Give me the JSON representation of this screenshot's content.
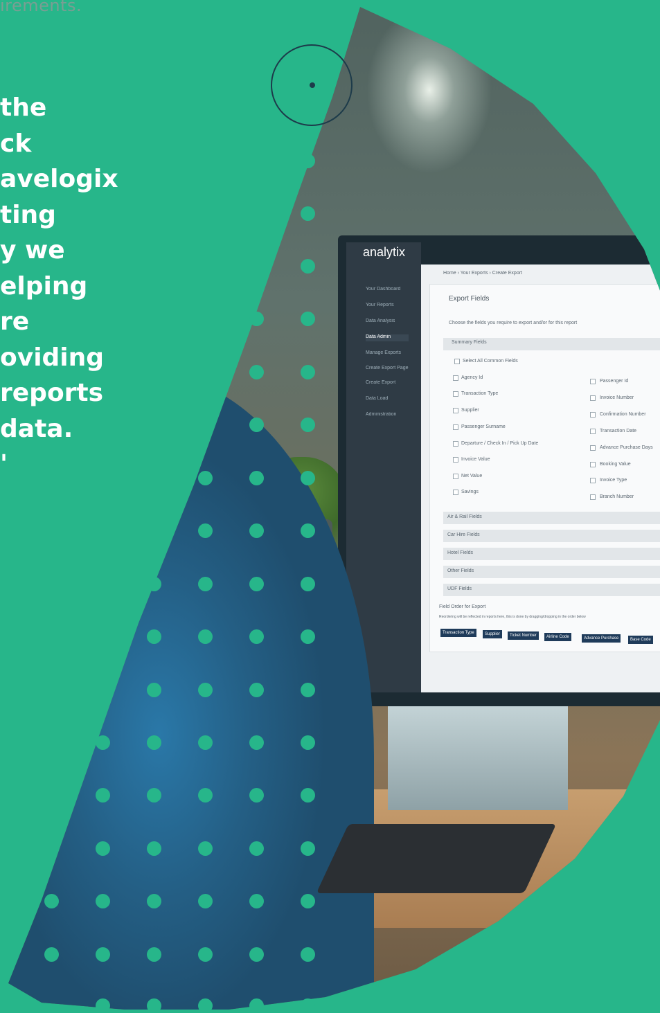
{
  "page": {
    "top_fragment": "irements.",
    "quote_lines": [
      "the",
      "ck",
      "avelogix",
      "ting",
      "y we",
      "elping",
      "re",
      "oviding",
      " reports",
      "data.",
      "'"
    ]
  },
  "screen": {
    "logo": "analytix",
    "breadcrumb": "Home › Your Exports › Create Export",
    "panel_title": "Export Fields",
    "instructions": "Choose the fields you require to export and/or for this report",
    "summary_label": "Summary Fields",
    "select_all": "Select All Common Fields",
    "left_fields": [
      "Agency Id",
      "Transaction Type",
      "Supplier",
      "Passenger Surname",
      "Departure / Check In / Pick Up Date",
      "Invoice Value",
      "Net Value",
      "Savings"
    ],
    "right_fields": [
      "Passenger Id",
      "Invoice Number",
      "Confirmation Number",
      "Transaction Date",
      "Advance Purchase Days",
      "Booking Value",
      "Invoice Type",
      "Branch Number"
    ],
    "sections": [
      "Air & Rail Fields",
      "Car Hire Fields",
      "Hotel Fields",
      "Other Fields",
      "UDF Fields"
    ],
    "order_label": "Field Order for Export",
    "order_help": "Reordering will be reflected in reports here, this is done by dragging/dropping in the order below",
    "order_tags": [
      "Transaction Type",
      "Supplier",
      "Ticket Number",
      "Airline Code",
      "Advance Purchase",
      "Base Code"
    ],
    "sidebar_items": [
      "Your Dashboard",
      "Your Reports",
      "Data Analysis",
      "Data Admin",
      "Manage Exports",
      "Create Export Page",
      "Create Export",
      "Data Load",
      "Administration"
    ]
  },
  "colors": {
    "background": "#27b68a",
    "quote_text": "#ffffff",
    "fragment_text": "#7a9e93",
    "ring": "#1d3b4a",
    "dot": "#27b68a"
  }
}
